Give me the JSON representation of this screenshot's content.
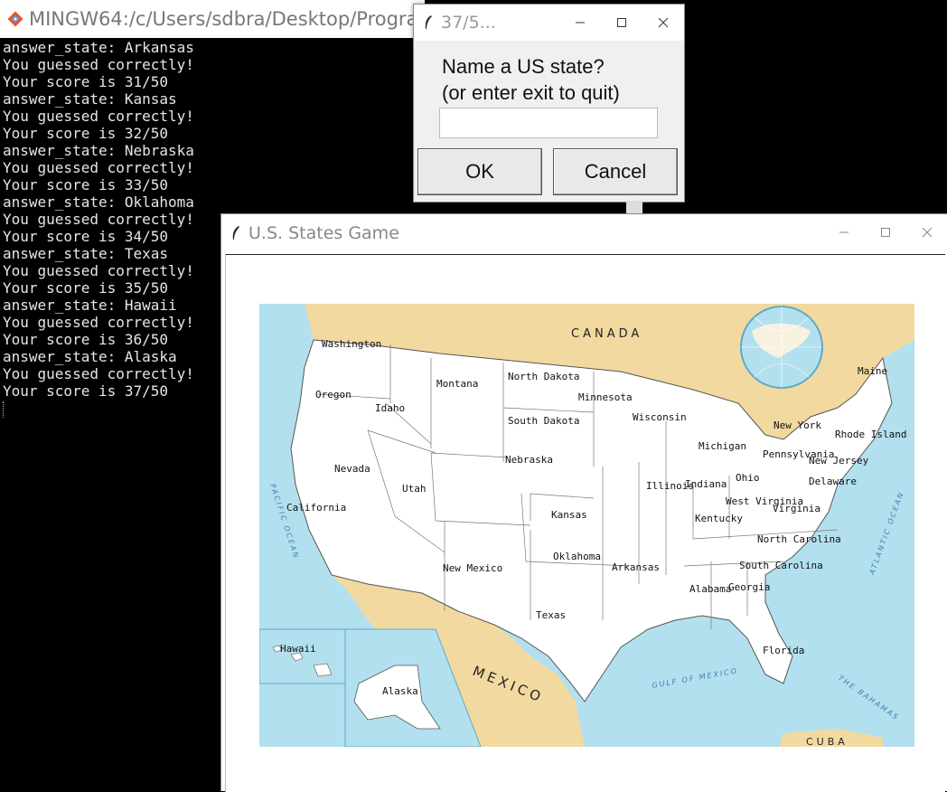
{
  "terminal": {
    "title": "MINGW64:/c/Users/sdbra/Desktop/Progra",
    "lines": [
      "answer_state: Arkansas",
      "You guessed correctly!",
      "Your score is 31/50",
      "answer_state: Kansas",
      "You guessed correctly!",
      "Your score is 32/50",
      "answer_state: Nebraska",
      "You guessed correctly!",
      "Your score is 33/50",
      "answer_state: Oklahoma",
      "You guessed correctly!",
      "Your score is 34/50",
      "answer_state: Texas",
      "You guessed correctly!",
      "Your score is 35/50",
      "answer_state: Hawaii",
      "You guessed correctly!",
      "Your score is 36/50",
      "answer_state: Alaska",
      "You guessed correctly!",
      "Your score is 37/50"
    ]
  },
  "dialog": {
    "title": "37/5...",
    "prompt_line1": "Name a US state?",
    "prompt_line2": "(or enter exit to quit)",
    "input_value": "",
    "ok_label": "OK",
    "cancel_label": "Cancel"
  },
  "game_window": {
    "title": "U.S. States Game"
  },
  "map": {
    "geo_labels": {
      "canada": "CANADA",
      "mexico": "MEXICO",
      "cuba": "CUBA",
      "pacific": "PACIFIC OCEAN",
      "atlantic": "ATLANTIC OCEAN",
      "gulf": "GULF OF MEXICO",
      "bahamas": "THE BAHAMAS"
    },
    "states": [
      "Washington",
      "Oregon",
      "Idaho",
      "Montana",
      "North Dakota",
      "Minnesota",
      "South Dakota",
      "Wisconsin",
      "Nevada",
      "Utah",
      "California",
      "Nebraska",
      "Michigan",
      "Maine",
      "New York",
      "Rhode Island",
      "Pennsylvania",
      "New Jersey",
      "Delaware",
      "Ohio",
      "Indiana",
      "Illinois",
      "West Virginia",
      "Virginia",
      "Kentucky",
      "Kansas",
      "North Carolina",
      "Oklahoma",
      "New Mexico",
      "Arkansas",
      "South Carolina",
      "Alabama",
      "Georgia",
      "Texas",
      "Florida",
      "Hawaii",
      "Alaska"
    ]
  },
  "colors": {
    "ocean": "#b3e0ee",
    "land_foreign": "#f2d9a0",
    "land_us": "#ffffff",
    "border": "#555555"
  }
}
